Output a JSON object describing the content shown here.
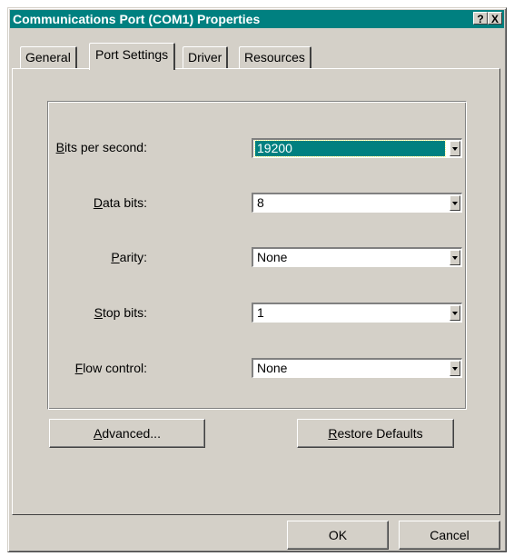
{
  "window": {
    "title": "Communications Port (COM1) Properties",
    "help_button": "?",
    "close_button": "X"
  },
  "tabs": [
    {
      "label": "General",
      "active": false
    },
    {
      "label": "Port Settings",
      "active": true
    },
    {
      "label": "Driver",
      "active": false
    },
    {
      "label": "Resources",
      "active": false
    }
  ],
  "settings": {
    "bits_per_second": {
      "label_key": "B",
      "label_rest": "its per second:",
      "value": "19200",
      "selected": true
    },
    "data_bits": {
      "label_key": "D",
      "label_rest": "ata bits:",
      "value": "8"
    },
    "parity": {
      "label_pre": "",
      "label_key": "P",
      "label_rest": "arity:",
      "value": "None"
    },
    "stop_bits": {
      "label_key": "S",
      "label_rest": "top bits:",
      "value": "1"
    },
    "flow_control": {
      "label_key": "F",
      "label_rest": "low control:",
      "value": "None"
    }
  },
  "buttons": {
    "advanced_key": "A",
    "advanced_rest": "dvanced...",
    "restore_key": "R",
    "restore_rest": "estore Defaults",
    "ok": "OK",
    "cancel": "Cancel"
  },
  "colors": {
    "face": "#d4d0c8",
    "titlebar": "#008080",
    "selection": "#008080"
  }
}
